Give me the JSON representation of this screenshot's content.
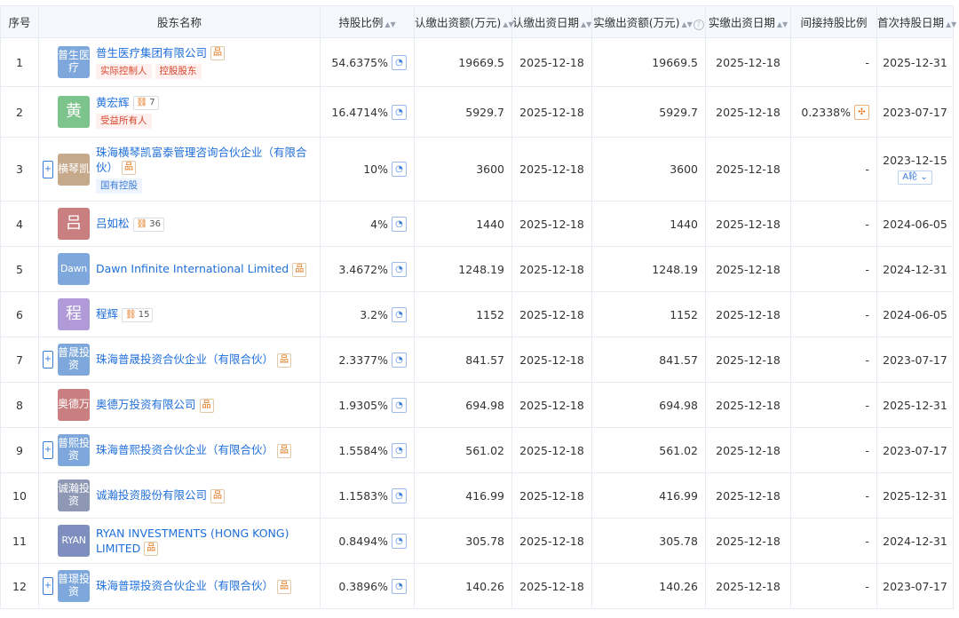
{
  "headers": {
    "index": "序号",
    "name": "股东名称",
    "ratio": "持股比例",
    "sub_amount": "认缴出资额(万元)",
    "sub_date": "认缴出资日期",
    "paid_amount": "实缴出资额(万元)",
    "paid_date": "实缴出资日期",
    "indirect": "间接持股比例",
    "first_date": "首次持股日期"
  },
  "icons": {
    "sort": "sort-icon",
    "help": "question-icon",
    "pie": "pie-chart-icon",
    "equity": "equity-structure-icon",
    "related": "related-companies-icon",
    "expand": "plus-icon"
  },
  "colors": {
    "link": "#1f6fdb",
    "tag_red": "#d7452c",
    "tag_blue": "#3a7bd5",
    "accent": "#e3700f"
  },
  "rows": [
    {
      "idx": "1",
      "logo": "普生医疗",
      "logo_color": "#7ea8dc",
      "name": "普生医疗集团有限公司",
      "tags": [
        {
          "text": "实际控制人",
          "kind": "red"
        },
        {
          "text": "控股股东",
          "kind": "red"
        }
      ],
      "pct": "54.6375%",
      "sub": "19669.5",
      "subdate": "2025-12-18",
      "paid": "19669.5",
      "paiddate": "2025-12-18",
      "indirect": "-",
      "first": "2025-12-31"
    },
    {
      "idx": "2",
      "logo": "黄",
      "logo_color": "#7cc48c",
      "name": "黄宏辉",
      "count": "7",
      "tags": [
        {
          "text": "受益所有人",
          "kind": "red"
        }
      ],
      "pct": "16.4714%",
      "sub": "5929.7",
      "subdate": "2025-12-18",
      "paid": "5929.7",
      "paiddate": "2025-12-18",
      "indirect": "0.2338%",
      "first": "2023-07-17"
    },
    {
      "idx": "3",
      "plus": true,
      "logo": "横琴凯",
      "logo_color": "#c6a88a",
      "name": "珠海横琴凯富泰管理咨询合伙企业（有限合伙）",
      "tags": [
        {
          "text": "国有控股",
          "kind": "blue"
        }
      ],
      "pct": "10%",
      "sub": "3600",
      "subdate": "2025-12-18",
      "paid": "3600",
      "paiddate": "2025-12-18",
      "indirect": "-",
      "first": "2023-12-15",
      "round": "A轮"
    },
    {
      "idx": "4",
      "logo": "吕",
      "logo_color": "#c97f7f",
      "name": "吕如松",
      "count": "36",
      "pct": "4%",
      "sub": "1440",
      "subdate": "2025-12-18",
      "paid": "1440",
      "paiddate": "2025-12-18",
      "indirect": "-",
      "first": "2024-06-05"
    },
    {
      "idx": "5",
      "logo": "Dawn",
      "logo_color": "#7ea8dc",
      "name": "Dawn Infinite International Limited",
      "pct": "3.4672%",
      "sub": "1248.19",
      "subdate": "2025-12-18",
      "paid": "1248.19",
      "paiddate": "2025-12-18",
      "indirect": "-",
      "first": "2024-12-31"
    },
    {
      "idx": "6",
      "logo": "程",
      "logo_color": "#b09ad8",
      "name": "程辉",
      "count": "15",
      "pct": "3.2%",
      "sub": "1152",
      "subdate": "2025-12-18",
      "paid": "1152",
      "paiddate": "2025-12-18",
      "indirect": "-",
      "first": "2024-06-05"
    },
    {
      "idx": "7",
      "plus": true,
      "logo": "普晟投资",
      "logo_color": "#7ea8dc",
      "name": "珠海普晟投资合伙企业（有限合伙）",
      "pct": "2.3377%",
      "sub": "841.57",
      "subdate": "2025-12-18",
      "paid": "841.57",
      "paiddate": "2025-12-18",
      "indirect": "-",
      "first": "2023-07-17"
    },
    {
      "idx": "8",
      "logo": "奥德万",
      "logo_color": "#c97f7f",
      "name": "奥德万投资有限公司",
      "pct": "1.9305%",
      "sub": "694.98",
      "subdate": "2025-12-18",
      "paid": "694.98",
      "paiddate": "2025-12-18",
      "indirect": "-",
      "first": "2025-12-31"
    },
    {
      "idx": "9",
      "plus": true,
      "logo": "普熙投资",
      "logo_color": "#7ea8dc",
      "name": "珠海普熙投资合伙企业（有限合伙）",
      "pct": "1.5584%",
      "sub": "561.02",
      "subdate": "2025-12-18",
      "paid": "561.02",
      "paiddate": "2025-12-18",
      "indirect": "-",
      "first": "2023-07-17"
    },
    {
      "idx": "10",
      "logo": "诚瀚投资",
      "logo_color": "#8e98b4",
      "name": "诚瀚投资股份有限公司",
      "pct": "1.1583%",
      "sub": "416.99",
      "subdate": "2025-12-18",
      "paid": "416.99",
      "paiddate": "2025-12-18",
      "indirect": "-",
      "first": "2025-12-31"
    },
    {
      "idx": "11",
      "logo": "RYAN",
      "logo_color": "#7e8fbf",
      "name": "RYAN INVESTMENTS (HONG KONG) LIMITED",
      "pct": "0.8494%",
      "sub": "305.78",
      "subdate": "2025-12-18",
      "paid": "305.78",
      "paiddate": "2025-12-18",
      "indirect": "-",
      "first": "2024-12-31"
    },
    {
      "idx": "12",
      "plus": true,
      "logo": "普璟投资",
      "logo_color": "#7ea8dc",
      "name": "珠海普璟投资合伙企业（有限合伙）",
      "pct": "0.3896%",
      "sub": "140.26",
      "subdate": "2025-12-18",
      "paid": "140.26",
      "paiddate": "2025-12-18",
      "indirect": "-",
      "first": "2023-07-17"
    }
  ]
}
